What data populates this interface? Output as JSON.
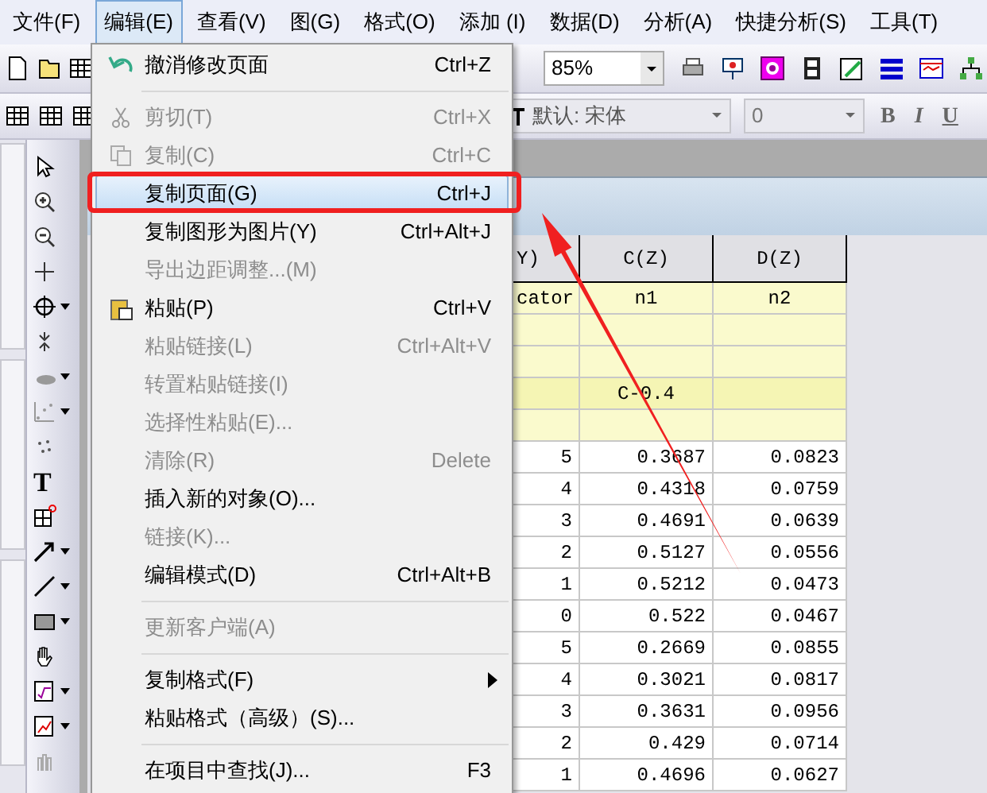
{
  "menubar": [
    {
      "label": "文件(F)",
      "selected": false
    },
    {
      "label": "编辑(E)",
      "selected": true
    },
    {
      "label": "查看(V)",
      "selected": false
    },
    {
      "label": "图(G)",
      "selected": false
    },
    {
      "label": "格式(O)",
      "selected": false
    },
    {
      "label": "添加 (I)",
      "selected": false
    },
    {
      "label": "数据(D)",
      "selected": false
    },
    {
      "label": "分析(A)",
      "selected": false
    },
    {
      "label": "快捷分析(S)",
      "selected": false
    },
    {
      "label": "工具(T)",
      "selected": false
    }
  ],
  "toolbar": {
    "zoom": "85%",
    "font": "默认: 宋体",
    "font_size": "0",
    "format_buttons": [
      "B",
      "I",
      "U"
    ]
  },
  "tools": {
    "text_tool": "T"
  },
  "edit_menu": [
    {
      "kind": "item",
      "label": "撤消修改页面",
      "shortcut": "Ctrl+Z",
      "disabled": false,
      "selected": false
    },
    {
      "kind": "separator"
    },
    {
      "kind": "item",
      "label": "剪切(T)",
      "shortcut": "Ctrl+X",
      "disabled": true,
      "selected": false
    },
    {
      "kind": "item",
      "label": "复制(C)",
      "shortcut": "Ctrl+C",
      "disabled": true,
      "selected": false
    },
    {
      "kind": "item",
      "label": "复制页面(G)",
      "shortcut": "Ctrl+J",
      "disabled": false,
      "selected": true
    },
    {
      "kind": "item",
      "label": "复制图形为图片(Y)",
      "shortcut": "Ctrl+Alt+J",
      "disabled": false,
      "selected": false
    },
    {
      "kind": "item",
      "label": "导出边距调整...(M)",
      "disabled": true,
      "selected": false
    },
    {
      "kind": "item",
      "label": "粘贴(P)",
      "shortcut": "Ctrl+V",
      "disabled": false,
      "selected": false
    },
    {
      "kind": "item",
      "label": "粘贴链接(L)",
      "shortcut": "Ctrl+Alt+V",
      "disabled": true,
      "selected": false
    },
    {
      "kind": "item",
      "label": "转置粘贴链接(I)",
      "disabled": true,
      "selected": false
    },
    {
      "kind": "item",
      "label": "选择性粘贴(E)...",
      "disabled": true,
      "selected": false
    },
    {
      "kind": "item",
      "label": "清除(R)",
      "shortcut": "Delete",
      "disabled": true,
      "selected": false
    },
    {
      "kind": "item",
      "label": "插入新的对象(O)...",
      "disabled": false,
      "selected": false
    },
    {
      "kind": "item",
      "label": "链接(K)...",
      "disabled": true,
      "selected": false
    },
    {
      "kind": "item",
      "label": "编辑模式(D)",
      "shortcut": "Ctrl+Alt+B",
      "disabled": false,
      "selected": false
    },
    {
      "kind": "separator"
    },
    {
      "kind": "item",
      "label": "更新客户端(A)",
      "disabled": true,
      "selected": false
    },
    {
      "kind": "separator"
    },
    {
      "kind": "item",
      "label": "复制格式(F)",
      "disabled": false,
      "selected": false,
      "submenu": true
    },
    {
      "kind": "item",
      "label": "粘贴格式（高级）(S)...",
      "disabled": false,
      "selected": false
    },
    {
      "kind": "separator"
    },
    {
      "kind": "item",
      "label": "在项目中查找(J)...",
      "shortcut": "F3",
      "disabled": false,
      "selected": false
    }
  ],
  "worksheet": {
    "columns": [
      "Y)",
      "C(Z)",
      "D(Z)"
    ],
    "label_rows": [
      {
        "col_b": "cator",
        "col_c": "n1",
        "col_d": "n2"
      },
      {},
      {},
      {
        "col_c": "C-0.4"
      },
      {}
    ],
    "rows": [
      [
        "5",
        "0.3687",
        "0.0823"
      ],
      [
        "4",
        "0.4318",
        "0.0759"
      ],
      [
        "3",
        "0.4691",
        "0.0639"
      ],
      [
        "2",
        "0.5127",
        "0.0556"
      ],
      [
        "1",
        "0.5212",
        "0.0473"
      ],
      [
        "0",
        "0.522",
        "0.0467"
      ],
      [
        "5",
        "0.2669",
        "0.0855"
      ],
      [
        "4",
        "0.3021",
        "0.0817"
      ],
      [
        "3",
        "0.3631",
        "0.0956"
      ],
      [
        "2",
        "0.429",
        "0.0714"
      ],
      [
        "1",
        "0.4696",
        "0.0627"
      ]
    ]
  }
}
